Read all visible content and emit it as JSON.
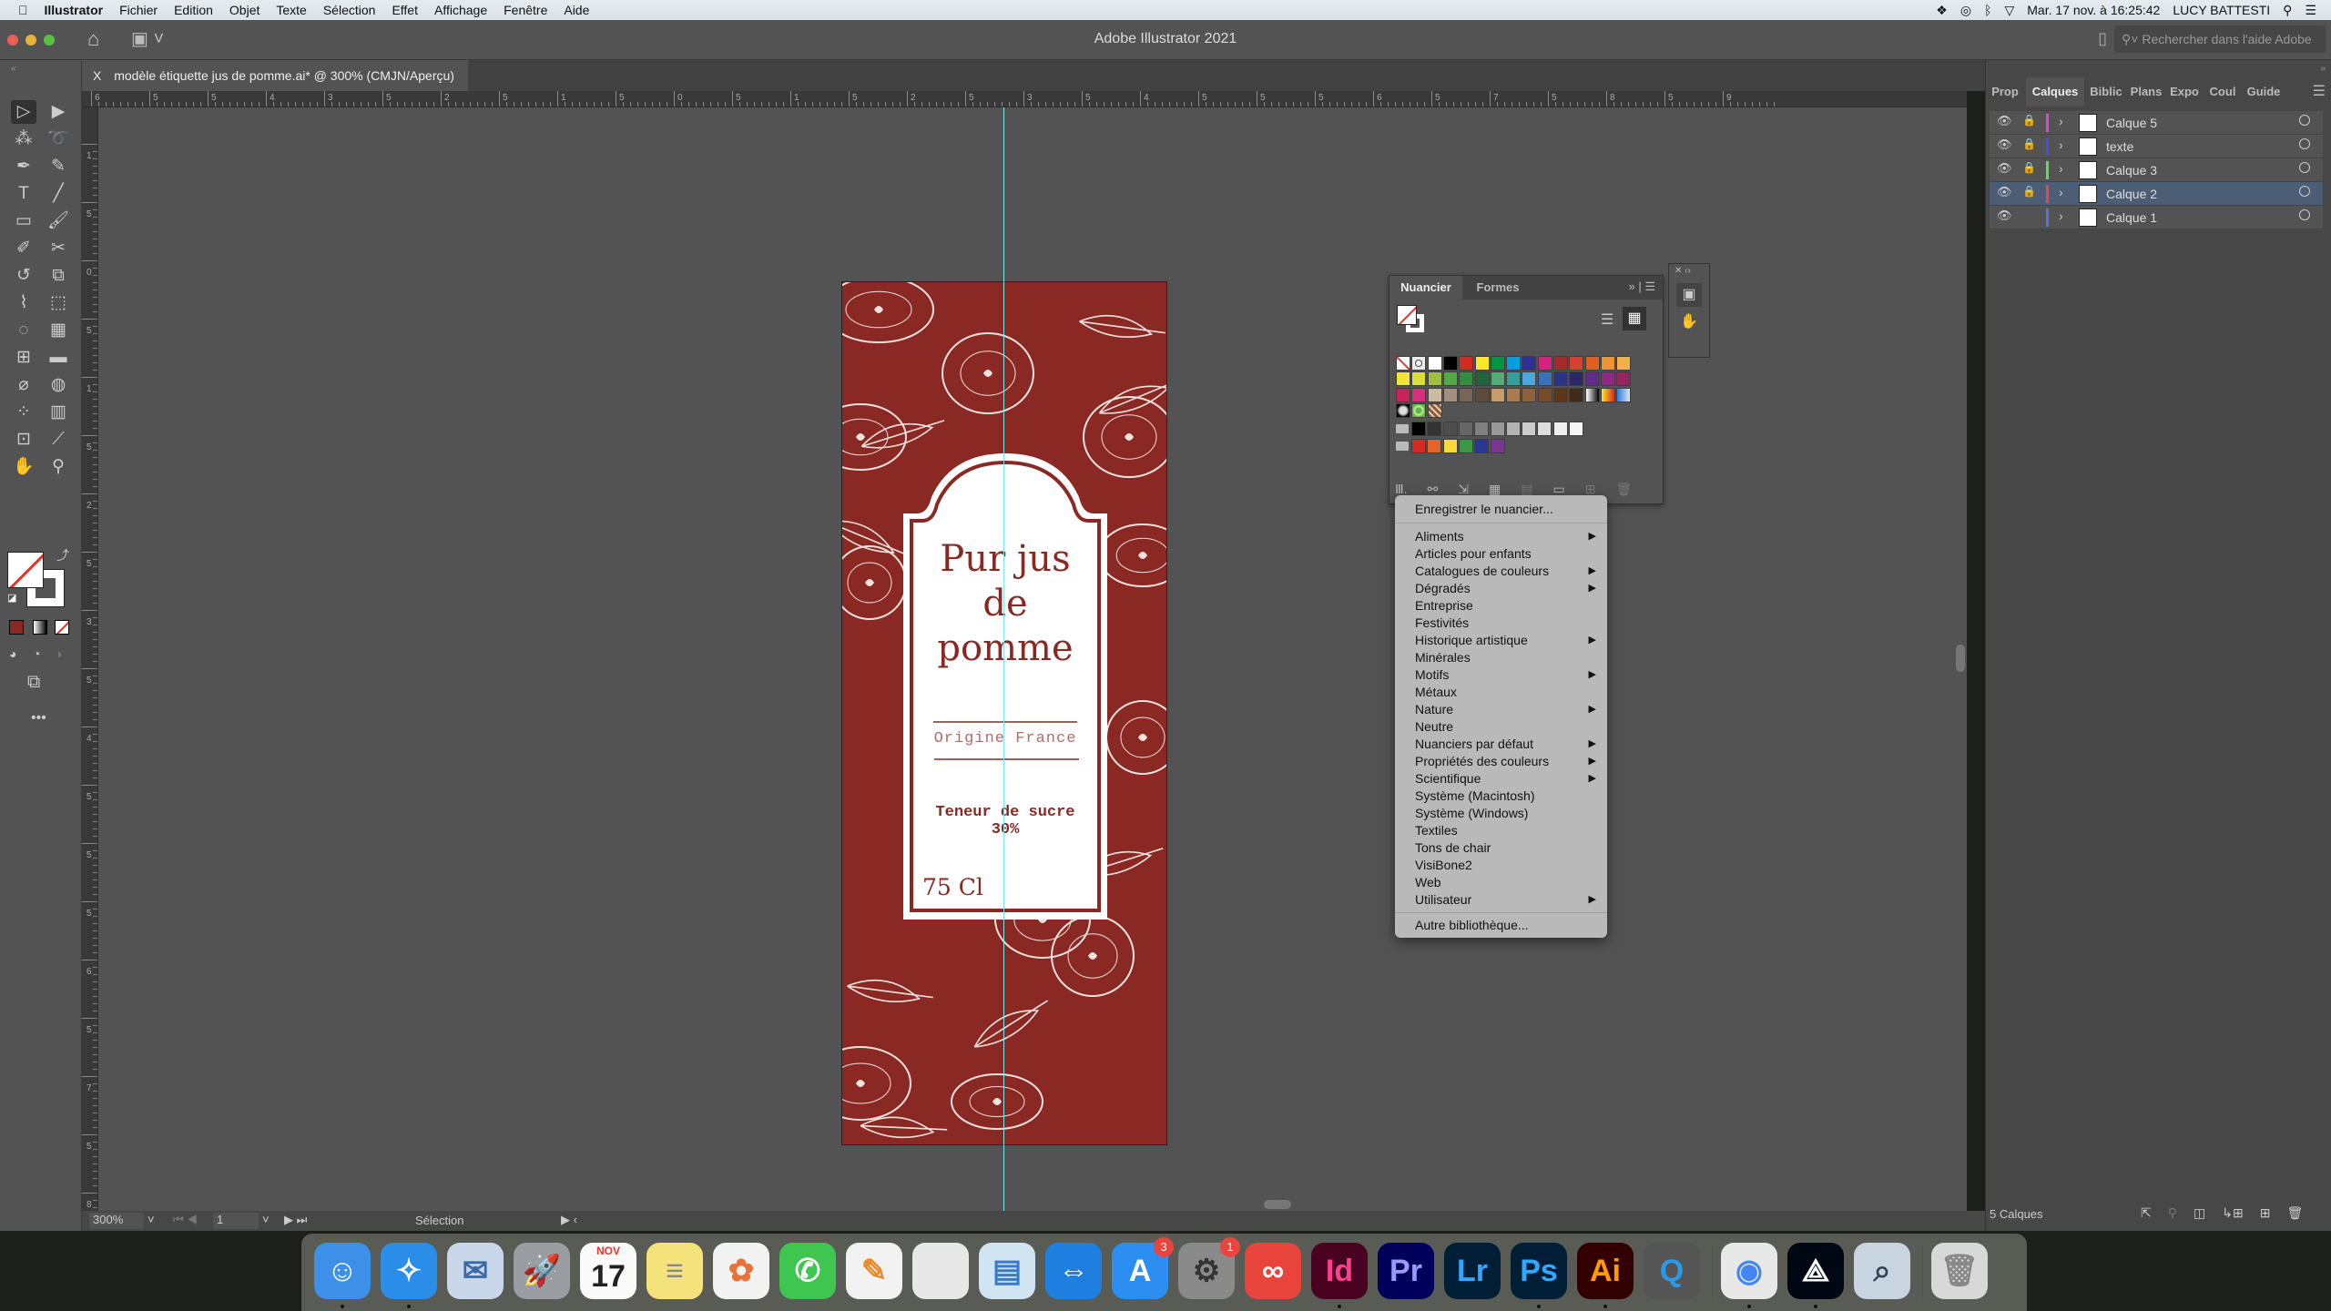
{
  "menubar": {
    "app": "Illustrator",
    "items": [
      "Fichier",
      "Edition",
      "Objet",
      "Texte",
      "Sélection",
      "Effet",
      "Affichage",
      "Fenêtre",
      "Aide"
    ],
    "datetime": "Mar. 17 nov. à 16:25:42",
    "user": "LUCY BATTESTI"
  },
  "appbar": {
    "title": "Adobe Illustrator 2021",
    "help_placeholder": "Rechercher dans l'aide Adobe"
  },
  "document": {
    "tab": "modèle étiquette jus de pomme.ai* @ 300% (CMJN/Aperçu)",
    "close": "X"
  },
  "tools": [
    [
      "selection",
      "▷"
    ],
    [
      "direct-selection",
      "▶"
    ],
    [
      "magic-wand",
      "⁂"
    ],
    [
      "lasso",
      "➰"
    ],
    [
      "pen",
      "✒"
    ],
    [
      "curvature",
      "✎"
    ],
    [
      "type",
      "T"
    ],
    [
      "line",
      "╱"
    ],
    [
      "rectangle",
      "▭"
    ],
    [
      "paintbrush",
      "🖌"
    ],
    [
      "shaper",
      "✐"
    ],
    [
      "scissors",
      "✂"
    ],
    [
      "rotate",
      "↺"
    ],
    [
      "scale",
      "⧉"
    ],
    [
      "puppet-warp",
      "⌇"
    ],
    [
      "free-transform",
      "⬚"
    ],
    [
      "shape-builder",
      "◌"
    ],
    [
      "perspective",
      "▦"
    ],
    [
      "mesh",
      "⊞"
    ],
    [
      "gradient",
      "▬"
    ],
    [
      "eyedropper",
      "⌀"
    ],
    [
      "blend",
      "◍"
    ],
    [
      "symbol-sprayer",
      "⁘"
    ],
    [
      "column-graph",
      "▥"
    ],
    [
      "artboard",
      "⊡"
    ],
    [
      "slice",
      "⟋"
    ],
    [
      "hand",
      "✋"
    ],
    [
      "zoom",
      "⚲"
    ]
  ],
  "ruler_top_labels": [
    "6",
    "5",
    "5",
    "4",
    "3",
    "5",
    "2",
    "5",
    "1",
    "5",
    "0",
    "5",
    "1",
    "5",
    "2",
    "5",
    "3",
    "5",
    "4",
    "5",
    "5",
    "5",
    "6",
    "5",
    "7",
    "5",
    "8",
    "5",
    "9"
  ],
  "ruler_left_labels": [
    "1",
    "5",
    "0",
    "5",
    "1",
    "5",
    "2",
    "5",
    "3",
    "5",
    "4",
    "5",
    "5",
    "5",
    "6",
    "5",
    "7",
    "5",
    "8"
  ],
  "artwork": {
    "title_lines": [
      "Pur jus",
      "de",
      "pomme"
    ],
    "origin": "Origine France",
    "sugar_label": "Teneur de sucre",
    "sugar_value": "30%",
    "volume": "75 Cl",
    "colors": {
      "background": "#8a2824",
      "panel": "#ffffff",
      "ink": "#8a2824"
    }
  },
  "status": {
    "zoom": "300%",
    "artboard": "1",
    "tool": "Sélection"
  },
  "right_panel": {
    "tabs": [
      "Prop",
      "Calques",
      "Biblic",
      "Plans",
      "Expo",
      "Coul",
      "Guide"
    ],
    "active_tab": "Calques",
    "layers": [
      {
        "name": "Calque 5",
        "color": "#e045e0",
        "locked": true,
        "selected": false
      },
      {
        "name": "texte",
        "color": "#4a4ae8",
        "locked": true,
        "selected": false
      },
      {
        "name": "Calque 3",
        "color": "#58e058",
        "locked": true,
        "selected": false
      },
      {
        "name": "Calque 2",
        "color": "#e24b4b",
        "locked": true,
        "selected": true
      },
      {
        "name": "Calque 1",
        "color": "#4a78e8",
        "locked": false,
        "selected": false
      }
    ],
    "footer": "5 Calques"
  },
  "swatches": {
    "tabs": [
      "Nuancier",
      "Formes"
    ],
    "active_tab": "Nuancier",
    "rows": [
      [
        "none",
        "registration",
        "#ffffff",
        "#000000",
        "#d42a22",
        "#fbe929",
        "#009245",
        "#00a0e0",
        "#2e3192",
        "#d4237d",
        "#a62a2b",
        "#d9412e",
        "#e15f27",
        "#ec9630",
        "#f0b24a"
      ],
      [
        "#f3e33a",
        "#d9df3a",
        "#a0c040",
        "#55a847",
        "#348d3f",
        "#21643a",
        "#52ac74",
        "#35a09a",
        "#4fa8dc",
        "#3872b6",
        "#2b3587",
        "#2a2767",
        "#5f2c8a",
        "#8e2881",
        "#932560"
      ],
      [
        "#c5235a",
        "#d4337b",
        "#cbbba0",
        "#a28f7f",
        "#776656",
        "#5f4b3d",
        "#c79c6c",
        "#a97b4f",
        "#8c623b",
        "#764d2b",
        "#5c3818",
        "#422a18",
        "grad-bw",
        "grad-yr",
        "grad-blue"
      ],
      [
        "pattern-dots",
        "pattern-green",
        "pattern-brown"
      ]
    ],
    "groups": [
      [
        "#000000",
        "#333333",
        "#4d4d4d",
        "#666666",
        "#808080",
        "#999999",
        "#b3b3b3",
        "#cccccc",
        "#dddddd",
        "#eeeeee",
        "#f7f7f7"
      ],
      [
        "#d42a22",
        "#e3652a",
        "#fbd93a",
        "#3a9844",
        "#2c3790",
        "#7a3791"
      ]
    ]
  },
  "context_menu": {
    "top": "Enregistrer le nuancier...",
    "items": [
      {
        "label": "Aliments",
        "sub": true
      },
      {
        "label": "Articles pour enfants",
        "sub": false
      },
      {
        "label": "Catalogues de couleurs",
        "sub": true
      },
      {
        "label": "Dégradés",
        "sub": true
      },
      {
        "label": "Entreprise",
        "sub": false
      },
      {
        "label": "Festivités",
        "sub": false
      },
      {
        "label": "Historique artistique",
        "sub": true
      },
      {
        "label": "Minérales",
        "sub": false
      },
      {
        "label": "Motifs",
        "sub": true
      },
      {
        "label": "Métaux",
        "sub": false
      },
      {
        "label": "Nature",
        "sub": true
      },
      {
        "label": "Neutre",
        "sub": false
      },
      {
        "label": "Nuanciers par défaut",
        "sub": true
      },
      {
        "label": "Propriétés des couleurs",
        "sub": true
      },
      {
        "label": "Scientifique",
        "sub": true
      },
      {
        "label": "Système (Macintosh)",
        "sub": false
      },
      {
        "label": "Système (Windows)",
        "sub": false
      },
      {
        "label": "Textiles",
        "sub": false
      },
      {
        "label": "Tons de chair",
        "sub": false
      },
      {
        "label": "VisiBone2",
        "sub": false
      },
      {
        "label": "Web",
        "sub": false
      },
      {
        "label": "Utilisateur",
        "sub": true
      }
    ],
    "bottom": "Autre bibliothèque..."
  },
  "dock": [
    {
      "name": "finder",
      "glyph": "☺",
      "bg": "#3d8fe8",
      "fg": "#fff",
      "running": true
    },
    {
      "name": "safari",
      "glyph": "✧",
      "bg": "#2a8de8",
      "fg": "#fff",
      "running": true
    },
    {
      "name": "mail",
      "glyph": "✉",
      "bg": "#c9d7ea",
      "fg": "#3a6aa8"
    },
    {
      "name": "launchpad",
      "glyph": "🚀",
      "bg": "#9a9ea3",
      "fg": "#333"
    },
    {
      "name": "calendar",
      "glyph": "17",
      "bg": "#fafafa",
      "fg": "#222",
      "label": "NOV"
    },
    {
      "name": "notes",
      "glyph": "≡",
      "bg": "#f4e27a",
      "fg": "#888"
    },
    {
      "name": "photos",
      "glyph": "✿",
      "bg": "#f2f2f2",
      "fg": "#e8733a"
    },
    {
      "name": "facetime",
      "glyph": "✆",
      "bg": "#3fc650",
      "fg": "#fff"
    },
    {
      "name": "pages",
      "glyph": "✎",
      "bg": "#f2f2f2",
      "fg": "#e88a2a"
    },
    {
      "name": "file",
      "glyph": "",
      "bg": "#e8e8e8",
      "fg": "#999"
    },
    {
      "name": "keynote",
      "glyph": "▤",
      "bg": "#d0e4f2",
      "fg": "#3a7ac8"
    },
    {
      "name": "teamviewer",
      "glyph": "⇔",
      "bg": "#1f7fe0",
      "fg": "#fff"
    },
    {
      "name": "app-store",
      "glyph": "A",
      "bg": "#2b8ef0",
      "fg": "#fff",
      "badge": "3"
    },
    {
      "name": "system-preferences",
      "glyph": "⚙",
      "bg": "#8a8a8a",
      "fg": "#333",
      "badge": "1"
    },
    {
      "name": "creative-cloud",
      "glyph": "∞",
      "bg": "#e8443c",
      "fg": "#fff"
    },
    {
      "name": "indesign",
      "glyph": "Id",
      "bg": "#49021f",
      "fg": "#ff3f8f",
      "running": true
    },
    {
      "name": "premiere",
      "glyph": "Pr",
      "bg": "#00005b",
      "fg": "#9999ff"
    },
    {
      "name": "lightroom",
      "glyph": "Lr",
      "bg": "#001e36",
      "fg": "#31a8ff"
    },
    {
      "name": "photoshop",
      "glyph": "Ps",
      "bg": "#001e36",
      "fg": "#31a8ff",
      "running": true
    },
    {
      "name": "illustrator",
      "glyph": "Ai",
      "bg": "#330000",
      "fg": "#ff9a00",
      "running": true
    },
    {
      "name": "quicktime",
      "glyph": "Q",
      "bg": "#555",
      "fg": "#2a9ae8"
    },
    {
      "name": "chrome",
      "glyph": "◉",
      "bg": "#e8e8e8",
      "fg": "#4285f4",
      "running": true
    },
    {
      "name": "acrobat",
      "glyph": "⟁",
      "bg": "#000814",
      "fg": "#fff",
      "running": true
    },
    {
      "name": "preview",
      "glyph": "⌕",
      "bg": "#c8d4e0",
      "fg": "#345"
    },
    {
      "name": "trash",
      "glyph": "🗑",
      "bg": "#d8d8d8",
      "fg": "#888"
    }
  ]
}
